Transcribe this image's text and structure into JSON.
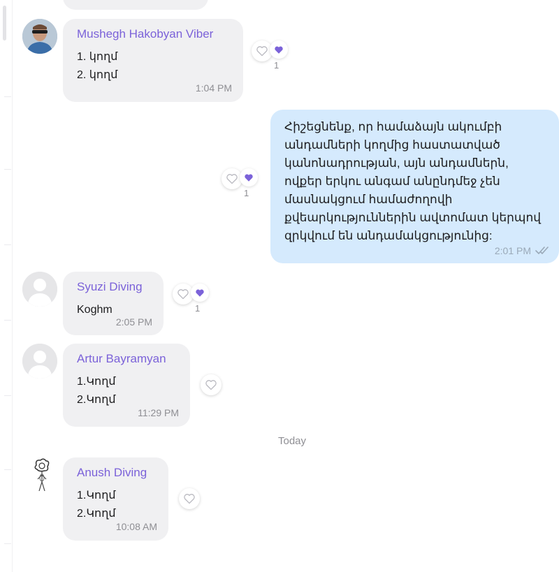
{
  "colors": {
    "accent_purple": "#7b62d9",
    "incoming_bubble": "#f0f0f2",
    "outgoing_bubble": "#d5eafd",
    "meta_text": "#8e8e93"
  },
  "messages": [
    {
      "sender": "Mushegh Hakobyan Viber",
      "lines": [
        "1. կողմ",
        "2. կողմ"
      ],
      "time": "1:04 PM",
      "avatar": "photo",
      "like_count": "1"
    },
    {
      "outgoing": true,
      "lines": [
        "Հիշեցնենք, որ համաձայն ակումբի",
        "անդամների կողմից հաստատված",
        "կանոնադրության, այն անդամներն,",
        "ովքեր երկու անգամ անընդմեջ չեն",
        "մասնակցում համաժողովի",
        "քվեարկություններին ավտոմատ կերպով",
        "զրկվում են անդամակցությունից:"
      ],
      "time": "2:01 PM",
      "status_icon": "double-check-icon",
      "like_count": "1"
    },
    {
      "sender": "Syuzi Diving",
      "lines": [
        "Koghm"
      ],
      "time": "2:05 PM",
      "avatar": "placeholder",
      "like_count": "1"
    },
    {
      "sender": "Artur Bayramyan",
      "lines": [
        "1.Կողմ",
        "2.Կողմ"
      ],
      "time": "11:29 PM",
      "avatar": "placeholder"
    },
    {
      "sender": "Anush Diving",
      "lines": [
        "1.Կողմ",
        "2.Կողմ"
      ],
      "time": "10:08 AM",
      "avatar": "sketch"
    }
  ],
  "day_separator": "Today"
}
